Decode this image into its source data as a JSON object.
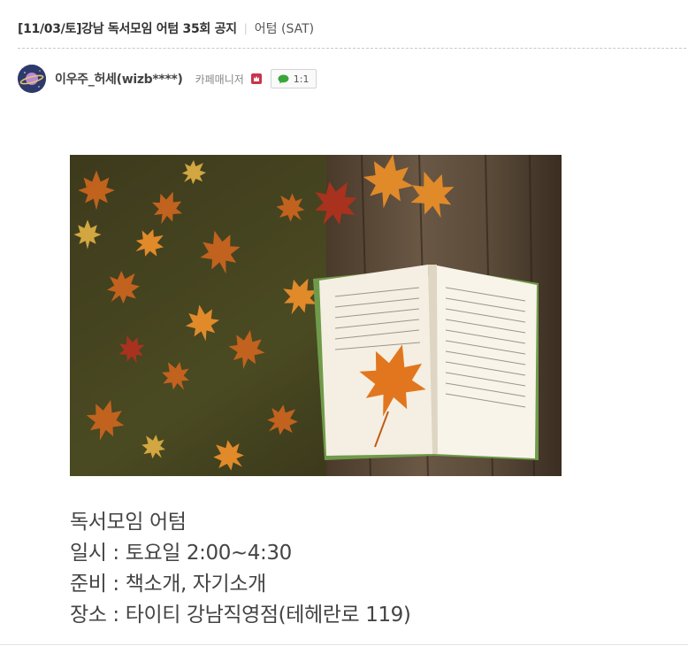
{
  "post": {
    "title": "[11/03/토]강남 독서모임 어텀 35회 공지",
    "board": "어텀 (SAT)"
  },
  "author": {
    "name": "이우주_허세(wizb****)",
    "role": "카페매니저",
    "chat_label": "1:1",
    "avatar_icon": "planet-icon"
  },
  "image": {
    "description_icon": "autumn-leaves-book-photo"
  },
  "content": {
    "lines": [
      "독서모임 어텀",
      "일시 : 토요일 2:00~4:30",
      "준비 : 책소개, 자기소개",
      "장소 : 타이티 강남직영점(테헤란로 119)"
    ]
  },
  "colors": {
    "manager_badge": "#c8344a",
    "chat_icon": "#3aa53a",
    "avatar_bg": "#2e3a6b"
  }
}
